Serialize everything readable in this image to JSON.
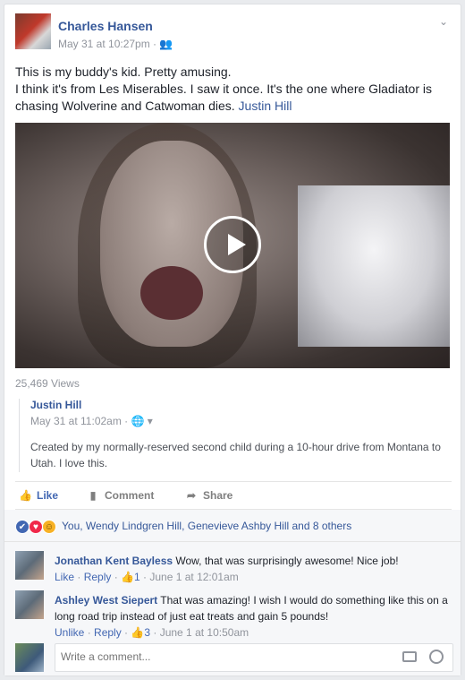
{
  "post": {
    "author": "Charles Hansen",
    "timestamp": "May 31 at 10:27pm · ",
    "audience_icon": "friends-icon",
    "text_line1": "This is my buddy's kid. Pretty amusing.",
    "text_line2": "I think it's from Les Miserables. I saw it once. It's the one where Gladiator is chasing Wolverine and Catwoman dies.",
    "tag": "Justin Hill",
    "views": "25,469 Views"
  },
  "shared": {
    "author": "Justin Hill",
    "timestamp": "May 31 at 11:02am · ",
    "audience_icon": "globe-icon",
    "text": "Created by my normally-reserved second child during a 10-hour drive from Montana to Utah. I love this."
  },
  "actions": {
    "like": "Like",
    "comment": "Comment",
    "share": "Share"
  },
  "reactions": {
    "summary": "You, Wendy Lindgren Hill, Genevieve Ashby Hill and 8 others"
  },
  "comments": [
    {
      "author": "Jonathan Kent Bayless",
      "text": "Wow, that was surprisingly awesome! Nice job!",
      "like_label": "Like",
      "reply_label": "Reply",
      "likes": "1",
      "time": "June 1 at 12:01am"
    },
    {
      "author": "Ashley West Siepert",
      "text": "That was amazing! I wish I would do something like this on a long road trip instead of just eat treats and gain 5 pounds!",
      "like_label": "Unlike",
      "reply_label": "Reply",
      "likes": "3",
      "time": "June 1 at 10:50am"
    }
  ],
  "composer": {
    "placeholder": "Write a comment..."
  },
  "colors": {
    "link": "#365899",
    "like_active": "#4267b2"
  }
}
